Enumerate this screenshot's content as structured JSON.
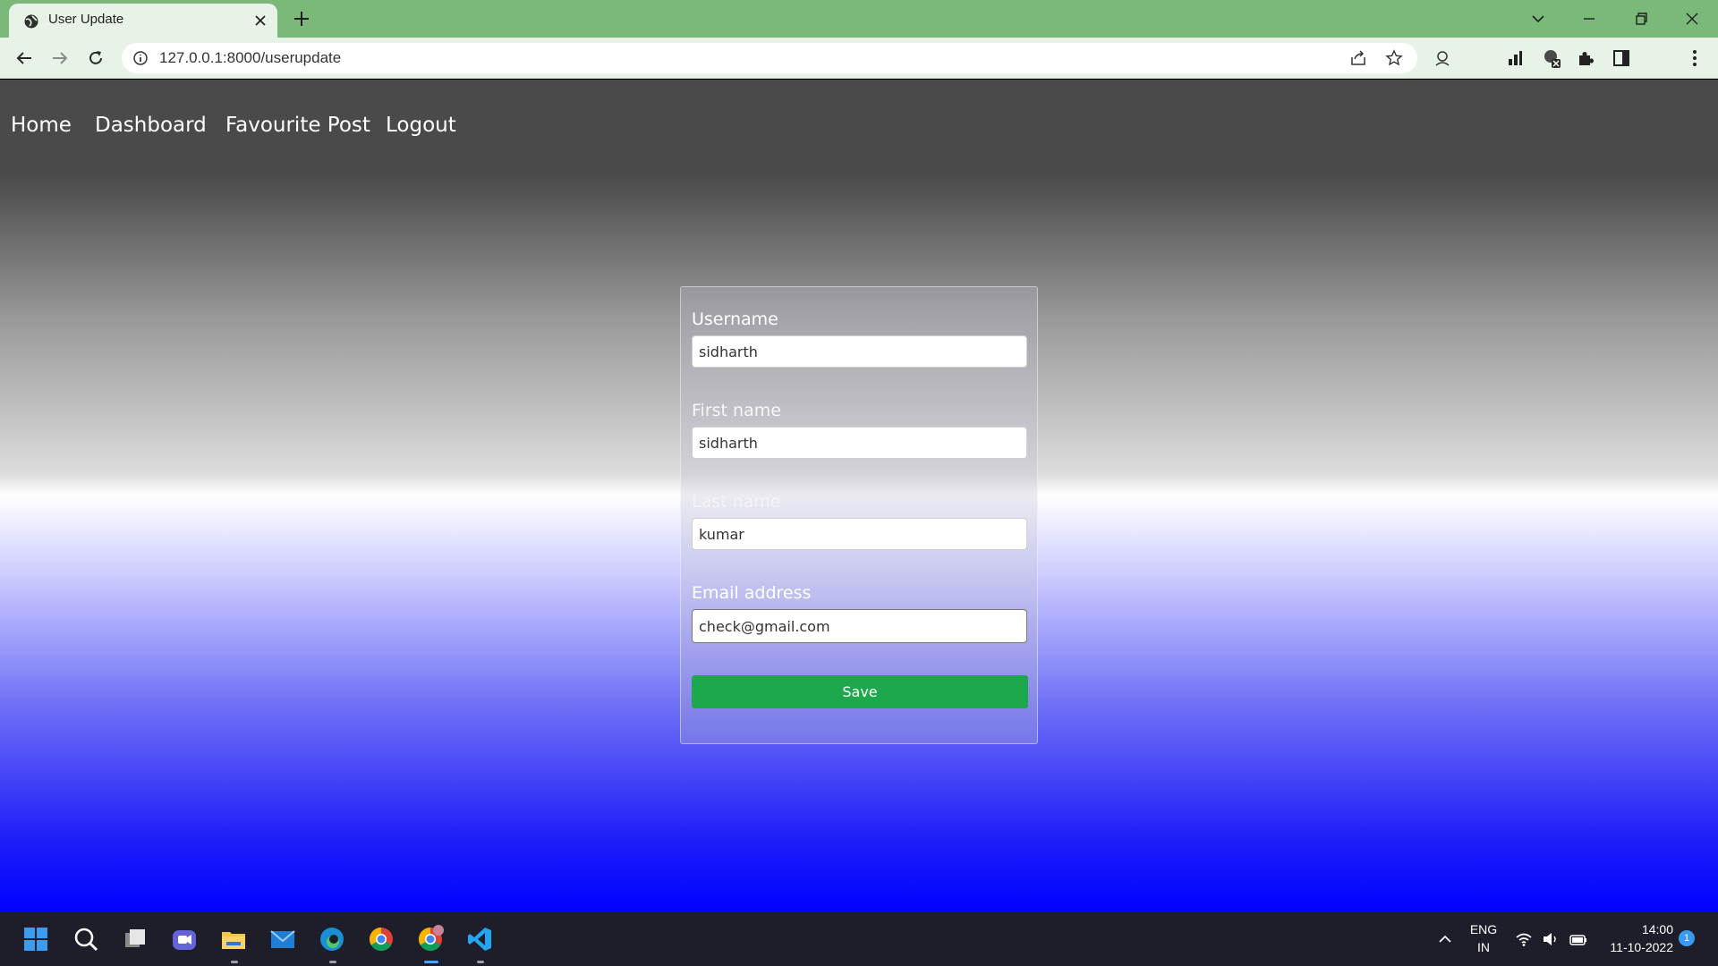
{
  "browser": {
    "tab_title": "User Update",
    "url": "127.0.0.1:8000/userupdate"
  },
  "nav": {
    "links": [
      "Home",
      "Dashboard",
      "Favourite Post",
      "Logout"
    ]
  },
  "form": {
    "fields": [
      {
        "label": "Username",
        "value": "sidharth",
        "label_color": "#ffffff"
      },
      {
        "label": "First name",
        "value": "sidharth",
        "label_color": "#f7f7f7"
      },
      {
        "label": "Last name",
        "value": "kumar",
        "label_color": "#f4f4f4"
      },
      {
        "label": "Email address",
        "value": "check@gmail.com",
        "label_color": "#ffffff"
      }
    ],
    "save_label": "Save",
    "save_color": "#1da84c"
  },
  "taskbar": {
    "lang_top": "ENG",
    "lang_bottom": "IN",
    "time": "14:00",
    "date": "11-10-2022",
    "notification_count": "1"
  },
  "colors": {
    "tabbar": "#7bb97b",
    "toolbar": "#e8f3e8",
    "navbar": "#4a4a4a",
    "page_bottom": "#0000ff"
  }
}
